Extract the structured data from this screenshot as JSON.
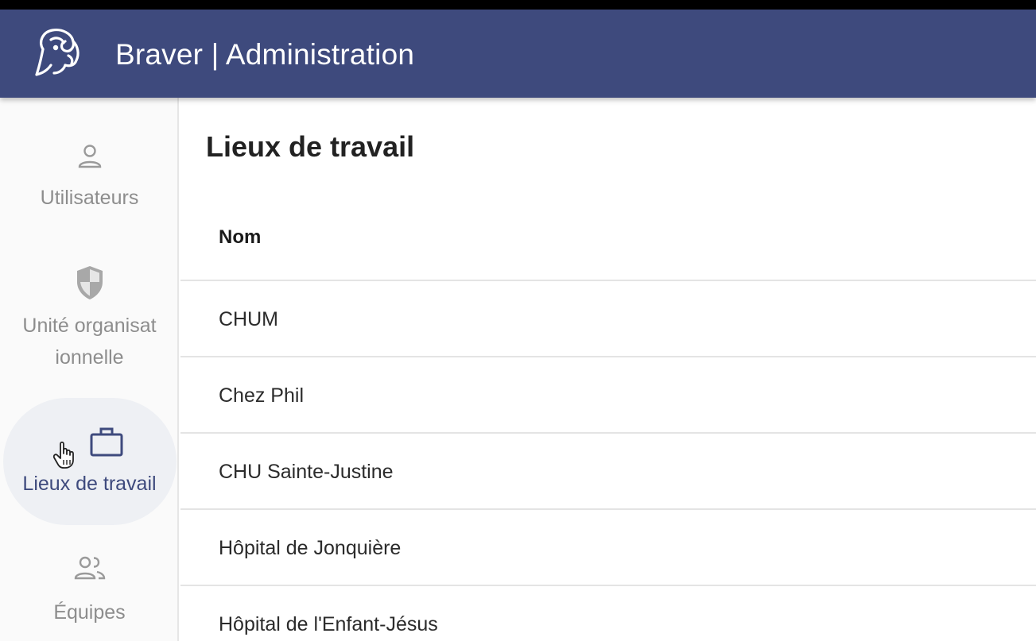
{
  "app": {
    "title": "Braver | Administration",
    "accent_color": "#3e4a7d",
    "logo_icon": "ram-head-logo"
  },
  "sidebar": {
    "items": [
      {
        "label": "Utilisateurs",
        "icon": "person-icon",
        "active": false
      },
      {
        "label": "Unité organisationnelle",
        "label_line1": "Unité organisat",
        "label_line2": "ionnelle",
        "icon": "shield-icon",
        "active": false
      },
      {
        "label": "Lieux de travail",
        "icon": "briefcase-icon",
        "active": true
      },
      {
        "label": "Équipes",
        "icon": "group-icon",
        "active": false
      }
    ]
  },
  "main": {
    "page_title": "Lieux de travail",
    "table": {
      "columns": [
        "Nom"
      ],
      "rows": [
        "CHUM",
        "Chez Phil",
        "CHU Sainte-Justine",
        "Hôpital de Jonquière",
        "Hôpital de l'Enfant-Jésus"
      ]
    }
  }
}
